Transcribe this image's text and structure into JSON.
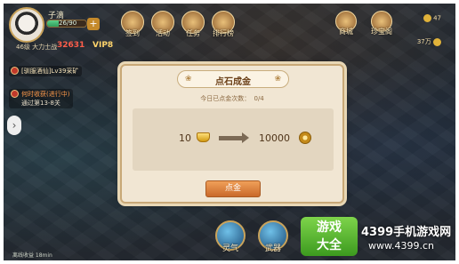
{
  "player": {
    "name": "子滴",
    "hp_text": "26/90",
    "hp_fraction": 0.29,
    "level_text": "46级 大力士战",
    "power_text": "32631",
    "vip": "VIP8"
  },
  "top_menu": [
    {
      "label": "签到",
      "icon": "sign-in-icon"
    },
    {
      "label": "活动",
      "icon": "event-icon"
    },
    {
      "label": "任务",
      "icon": "task-icon"
    },
    {
      "label": "排行榜",
      "icon": "ranking-icon"
    }
  ],
  "right_menu": [
    {
      "label": "商城",
      "icon": "shop-icon"
    },
    {
      "label": "珍宝阁",
      "icon": "treasure-icon"
    }
  ],
  "currency": {
    "gold": "47",
    "coins": "37万"
  },
  "quests": [
    {
      "title": "[驯服酒仙]Lv39采矿",
      "sub": ""
    },
    {
      "title": "何时收获(进行中)",
      "sub": "通过第13-8关"
    }
  ],
  "bottom_buttons": [
    {
      "label": "灵气",
      "icon": "spirit-icon"
    },
    {
      "label": "武器",
      "icon": "weapon-icon"
    }
  ],
  "bottom_left_text": "离线收益 18min",
  "dialog": {
    "title": "点石成金",
    "count_label": "今日已点金次数：",
    "count_value": "0/4",
    "cost_value": "10",
    "cost_icon": "gold-ingot-icon",
    "gain_value": "10000",
    "gain_icon": "coin-icon",
    "confirm_label": "点金"
  },
  "watermark": {
    "box_line1": "游戏",
    "box_line2": "大全",
    "text": "4399手机游戏网",
    "url": "www.4399.cn"
  }
}
